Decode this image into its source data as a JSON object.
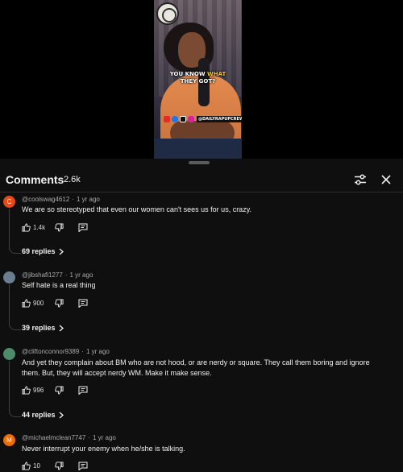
{
  "video": {
    "caption_line1_a": "YOU KNOW ",
    "caption_line1_b": "WHAT",
    "caption_line2": "THEY GOT?",
    "social_handle": "@DAILYRAPUPCREW"
  },
  "comments_panel": {
    "title": "Comments",
    "count": "2.6k",
    "filter_icon": "sliders-icon",
    "close_icon": "close-icon"
  },
  "comments": [
    {
      "author": "@coolswag4612",
      "time": "1 yr ago",
      "avatar_letter": "C",
      "avatar_color": "#e64a19",
      "text": "We are so stereotyped that even our women can't sees us for us, crazy.",
      "likes": "1.4k",
      "replies": "69 replies"
    },
    {
      "author": "@jibshafi1277",
      "time": "1 yr ago",
      "avatar_letter": "",
      "avatar_color": "#6b7d90",
      "text": "Self hate is a real thing",
      "likes": "900",
      "replies": "39 replies"
    },
    {
      "author": "@cliftonconnor9389",
      "time": "1 yr ago",
      "avatar_letter": "",
      "avatar_color": "#4f8a6b",
      "text": "And yet they complain about BM who are not hood, or are nerdy or square. They call them boring and ignore them. But, they will accept nerdy WM. Make it make sense.",
      "likes": "996",
      "replies": "44 replies"
    },
    {
      "author": "@michaelmclean7747",
      "time": "1 yr ago",
      "avatar_letter": "M",
      "avatar_color": "#ef6c00",
      "text": "Never interrupt your enemy when he/she is talking.",
      "likes": "10",
      "replies": ""
    }
  ]
}
